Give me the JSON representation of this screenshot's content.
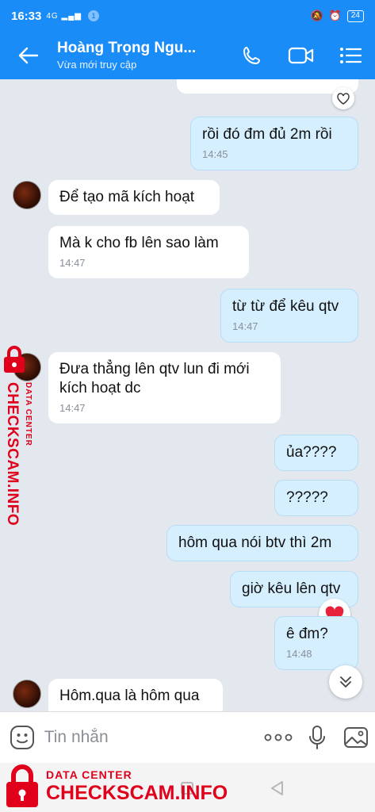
{
  "status_bar": {
    "time": "16:33",
    "signal": "4G",
    "notif_count": "1",
    "battery": "24"
  },
  "header": {
    "name": "Hoàng Trọng Ngu...",
    "status": "Vừa mới truy cập"
  },
  "messages": [
    {
      "dir": "out",
      "text": "rồi đó đm đủ 2m rồi",
      "time": "14:45"
    },
    {
      "dir": "in",
      "text": "Để tạo mã kích hoạt",
      "time": ""
    },
    {
      "dir": "in",
      "text": "Mà k cho fb lên sao làm",
      "time": "14:47"
    },
    {
      "dir": "out",
      "text": "từ từ để kêu qtv",
      "time": "14:47"
    },
    {
      "dir": "in",
      "text": "Đưa thẳng lên qtv lun đi mới kích hoạt dc",
      "time": "14:47"
    },
    {
      "dir": "out",
      "text": "ủa????",
      "time": ""
    },
    {
      "dir": "out",
      "text": "?????",
      "time": ""
    },
    {
      "dir": "out",
      "text": "hôm qua nói btv thì 2m",
      "time": ""
    },
    {
      "dir": "out",
      "text": "giờ kêu lên qtv",
      "time": ""
    },
    {
      "dir": "out",
      "text": "ê đm?",
      "time": "14:48"
    },
    {
      "dir": "in",
      "text": "Hôm.qua là hôm qua",
      "time": ""
    }
  ],
  "input": {
    "placeholder": "Tin nhắn"
  },
  "watermark": {
    "small": "DATA CENTER",
    "big": "CHECKSCAM.INFO"
  },
  "colors": {
    "header": "#1a8cf7",
    "outgoing_bubble": "#d5efff",
    "incoming_bubble": "#ffffff",
    "background": "#e3e8ee",
    "watermark": "#e0001b"
  },
  "icons": [
    "back-arrow-icon",
    "phone-icon",
    "video-call-icon",
    "menu-list-icon",
    "heart-icon",
    "sticker-icon",
    "more-dots-icon",
    "microphone-icon",
    "image-icon",
    "double-chevron-down-icon",
    "lock-icon"
  ]
}
